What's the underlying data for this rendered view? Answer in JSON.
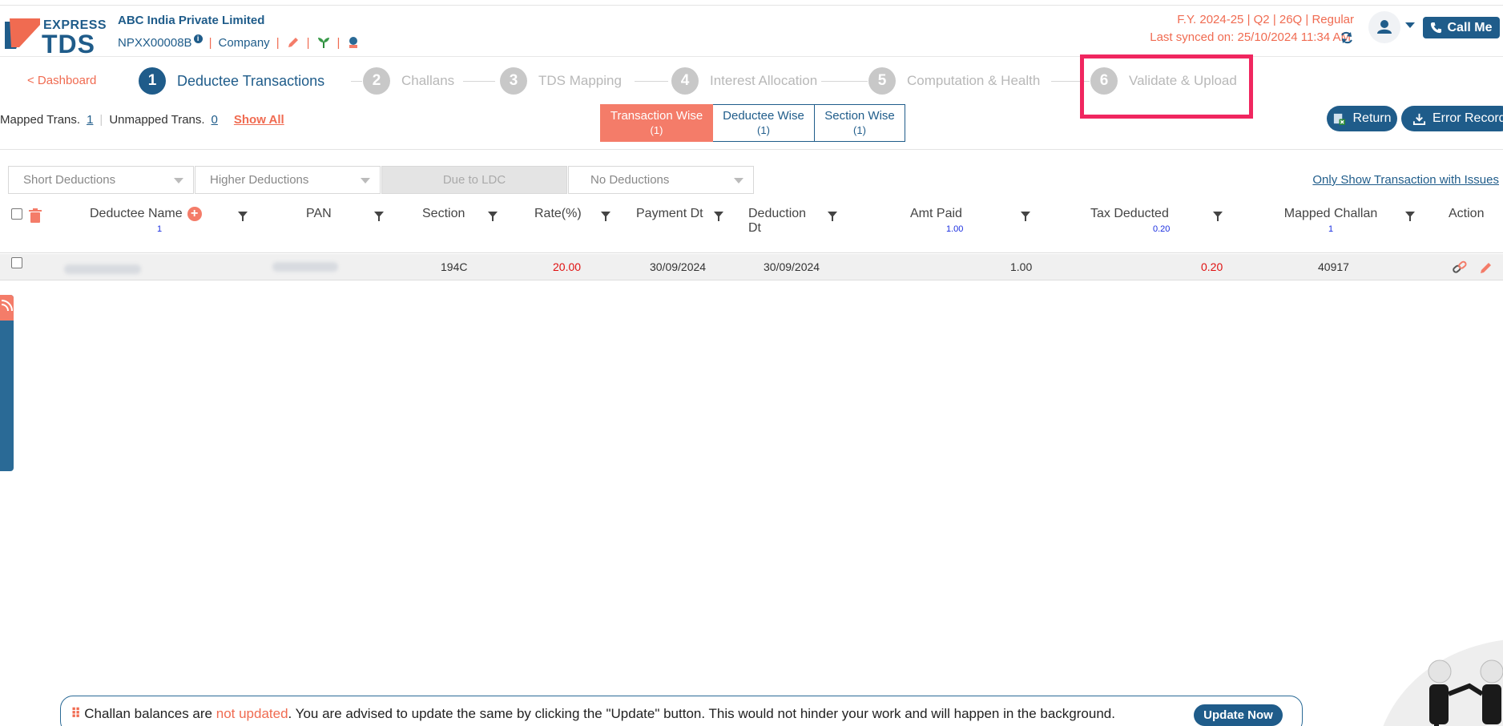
{
  "header": {
    "logo_express": "EXPRESS",
    "logo_tds": "TDS",
    "company_name": "ABC India Private Limited",
    "tan": "NPXX00008B",
    "entity_type": "Company",
    "fy_line": "F.Y. 2024-25  | Q2  | 26Q | Regular",
    "last_synced": "Last synced on: 25/10/2024 11:34 AM",
    "call_me": "Call Me"
  },
  "nav": {
    "dashboard": "< Dashboard",
    "steps": [
      {
        "num": "1",
        "label": "Deductee Transactions"
      },
      {
        "num": "2",
        "label": "Challans"
      },
      {
        "num": "3",
        "label": "TDS Mapping"
      },
      {
        "num": "4",
        "label": "Interest Allocation"
      },
      {
        "num": "5",
        "label": "Computation & Health"
      },
      {
        "num": "6",
        "label": "Validate & Upload"
      }
    ]
  },
  "summary": {
    "mapped_label": "Mapped Trans.",
    "mapped_count": "1",
    "unmapped_label": "Unmapped Trans.",
    "unmapped_count": "0",
    "show_all": "Show All"
  },
  "view_tabs": [
    {
      "label": "Transaction Wise",
      "count": "(1)"
    },
    {
      "label": "Deductee Wise",
      "count": "(1)"
    },
    {
      "label": "Section Wise",
      "count": "(1)"
    }
  ],
  "actions": {
    "return": "Return",
    "error_records": "Error Records"
  },
  "filters": {
    "short": "Short Deductions",
    "higher": "Higher Deductions",
    "ldc": "Due to LDC",
    "none": "No Deductions",
    "only_issues": "Only Show Transaction with Issues"
  },
  "table": {
    "columns": {
      "deductee_name": "Deductee Name",
      "deductee_name_count": "1",
      "pan": "PAN",
      "section": "Section",
      "rate": "Rate(%)",
      "payment_dt": "Payment Dt",
      "deduction_dt_1": "Deduction",
      "deduction_dt_2": "Dt",
      "amt_paid": "Amt Paid",
      "amt_paid_total": "1.00",
      "tax_deducted": "Tax Deducted",
      "tax_deducted_total": "0.20",
      "mapped_challan": "Mapped Challan",
      "mapped_challan_count": "1",
      "action": "Action"
    },
    "rows": [
      {
        "section": "194C",
        "rate": "20.00",
        "payment_dt": "30/09/2024",
        "deduction_dt": "30/09/2024",
        "amt_paid": "1.00",
        "tax_deducted": "0.20",
        "mapped_challan": "40917"
      }
    ]
  },
  "notice": {
    "part1": "Challan balances are ",
    "warn": "not updated",
    "part2": ". You are advised to update the same by clicking the \"Update\" button. This would not hinder your work and will happen in the background.",
    "button": "Update Now"
  },
  "colors": {
    "brand_blue": "#1f5c8a",
    "accent_orange": "#f06b51",
    "highlight": "#f0265f"
  }
}
